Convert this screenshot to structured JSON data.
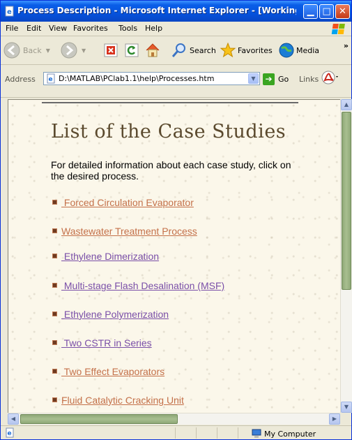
{
  "window": {
    "title": "Process Description - Microsoft Internet Explorer - [Working O...",
    "minimize": "▁",
    "maximize": "□",
    "close": "✕"
  },
  "menu": [
    "File",
    "Edit",
    "View",
    "Favorites",
    "Tools",
    "Help"
  ],
  "toolbar": {
    "back_label": "Back",
    "search_label": "Search",
    "favorites_label": "Favorites",
    "media_label": "Media",
    "more": "»"
  },
  "address": {
    "label": "Address",
    "value": "D:\\MATLAB\\PClab1.1\\help\\Processes.htm",
    "go_label": "Go",
    "links_label": "Links"
  },
  "page": {
    "title": "List of the Case Studies",
    "intro": "For detailed information about each case study, click on the desired process.",
    "cases": [
      {
        "label": " Forced Circulation Evaporator",
        "visited": false
      },
      {
        "label": "Wastewater Treatment Process",
        "visited": false
      },
      {
        "label": " Ethylene Dimerization",
        "visited": true
      },
      {
        "label": " Multi-stage Flash Desalination (MSF)",
        "visited": true
      },
      {
        "label": " Ethylene Polymerization",
        "visited": true
      },
      {
        "label": " Two CSTR in Series",
        "visited": true
      },
      {
        "label": " Two Effect Evaporators",
        "visited": false
      },
      {
        "label": "Fluid Catalytic Cracking Unit",
        "visited": false
      }
    ]
  },
  "status": {
    "zone": "My Computer"
  },
  "colors": {
    "link": "#c4714a",
    "visited_link": "#7a4fa8",
    "title": "#5b4a2e"
  }
}
